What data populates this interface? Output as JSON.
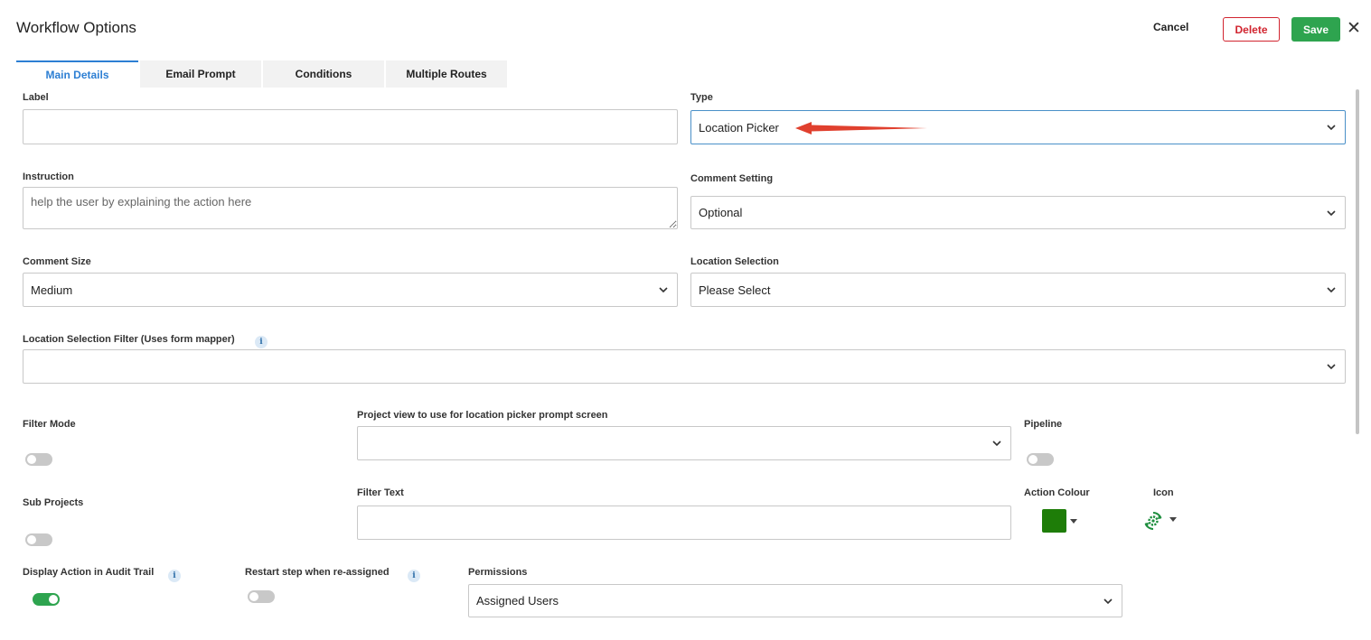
{
  "header": {
    "title": "Workflow Options",
    "cancel_label": "Cancel",
    "delete_label": "Delete",
    "save_label": "Save",
    "close_glyph": "✕"
  },
  "tabs": [
    {
      "label": "Main Details",
      "active": true
    },
    {
      "label": "Email Prompt",
      "active": false
    },
    {
      "label": "Conditions",
      "active": false
    },
    {
      "label": "Multiple Routes",
      "active": false
    }
  ],
  "form": {
    "label": {
      "label": "Label",
      "value": ""
    },
    "type": {
      "label": "Type",
      "value": "Location Picker"
    },
    "instruction": {
      "label": "Instruction",
      "value": "",
      "placeholder": "help the user by explaining the action here"
    },
    "comment_setting": {
      "label": "Comment Setting",
      "value": "Optional"
    },
    "comment_size": {
      "label": "Comment Size",
      "value": "Medium"
    },
    "location_selection": {
      "label": "Location Selection",
      "value": "Please Select"
    },
    "location_filter": {
      "label": "Location Selection Filter (Uses form mapper)",
      "value": ""
    },
    "filter_mode": {
      "label": "Filter Mode",
      "on": false
    },
    "project_view": {
      "label": "Project view to use for location picker prompt screen",
      "value": ""
    },
    "pipeline": {
      "label": "Pipeline",
      "on": false
    },
    "sub_projects": {
      "label": "Sub Projects",
      "on": false
    },
    "filter_text": {
      "label": "Filter Text",
      "value": ""
    },
    "action_colour": {
      "label": "Action Colour",
      "color": "#1e7d08"
    },
    "icon": {
      "label": "Icon",
      "name": "cog-sync-icon",
      "color": "#1e8e3e"
    },
    "display_audit": {
      "label": "Display Action in Audit Trail",
      "on": true
    },
    "restart_step": {
      "label": "Restart step when re-assigned",
      "on": false
    },
    "permissions": {
      "label": "Permissions",
      "value": "Assigned Users"
    }
  },
  "colors": {
    "accent": "#2d7fd3",
    "save": "#2ea44f",
    "delete": "#d1242f",
    "annotation_arrow": "#e0402e"
  }
}
